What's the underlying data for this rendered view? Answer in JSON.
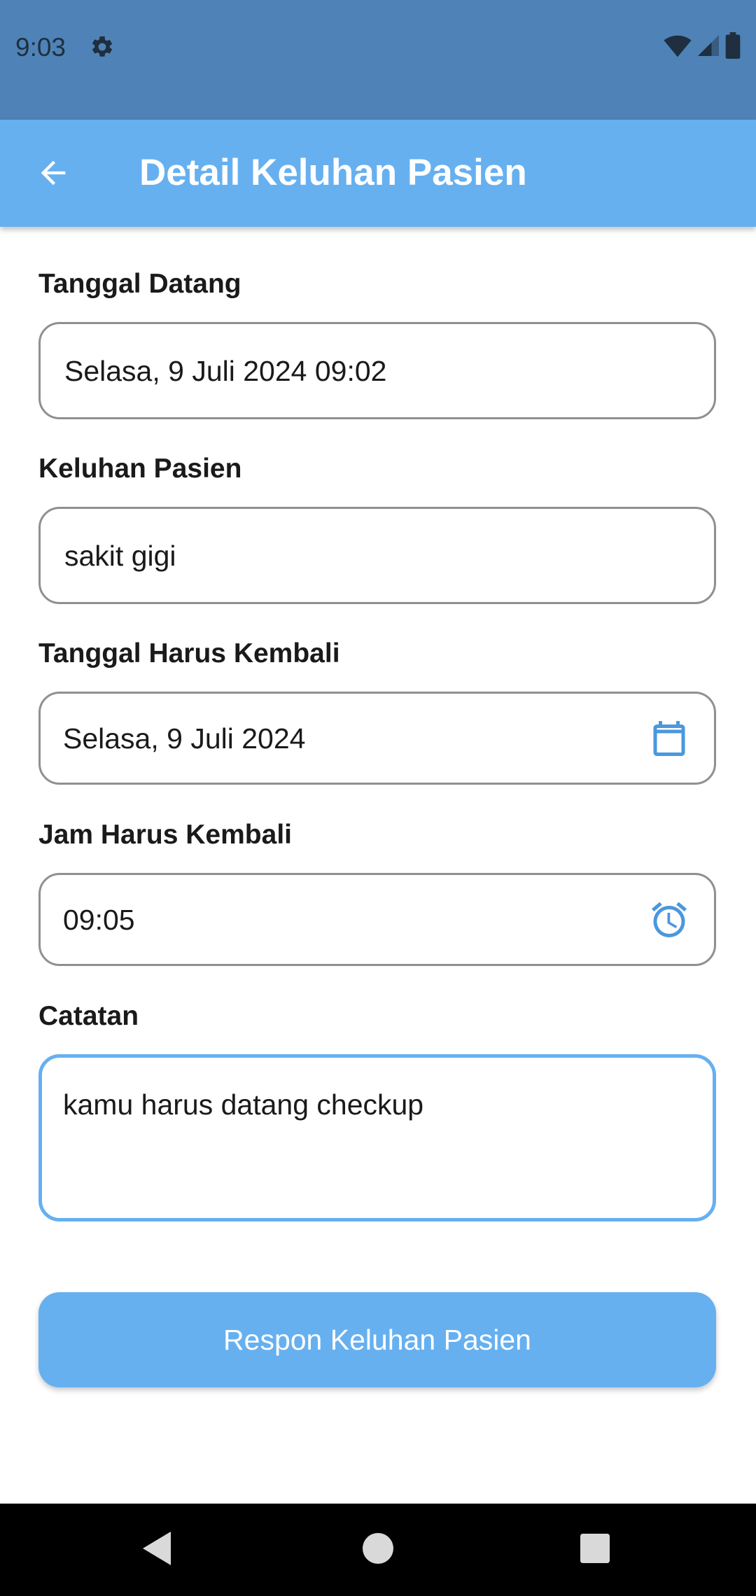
{
  "status_bar": {
    "time": "9:03",
    "icons": [
      "gear-icon",
      "wifi-icon",
      "signal-icon",
      "battery-icon"
    ]
  },
  "app_bar": {
    "title": "Detail Keluhan Pasien",
    "back_icon": "arrow-back-icon"
  },
  "form": {
    "tanggal_datang": {
      "label": "Tanggal Datang",
      "value": "Selasa, 9 Juli 2024 09:02"
    },
    "keluhan_pasien": {
      "label": "Keluhan Pasien",
      "value": "sakit gigi"
    },
    "tanggal_kembali": {
      "label": "Tanggal Harus Kembali",
      "value": "Selasa, 9 Juli 2024",
      "icon": "calendar-icon"
    },
    "jam_kembali": {
      "label": "Jam Harus Kembali",
      "value": "09:05",
      "icon": "alarm-clock-icon"
    },
    "catatan": {
      "label": "Catatan",
      "value": "kamu harus datang checkup"
    }
  },
  "submit_button": {
    "label": "Respon Keluhan Pasien"
  },
  "nav_bar": {
    "items": [
      "back-triangle-icon",
      "home-circle-icon",
      "recents-square-icon"
    ]
  },
  "colors": {
    "status_bar": "#4f83b7",
    "app_bar": "#66b0f0",
    "accent": "#66b0f0",
    "field_border": "#8f8f94",
    "nav_bar": "#000000"
  }
}
